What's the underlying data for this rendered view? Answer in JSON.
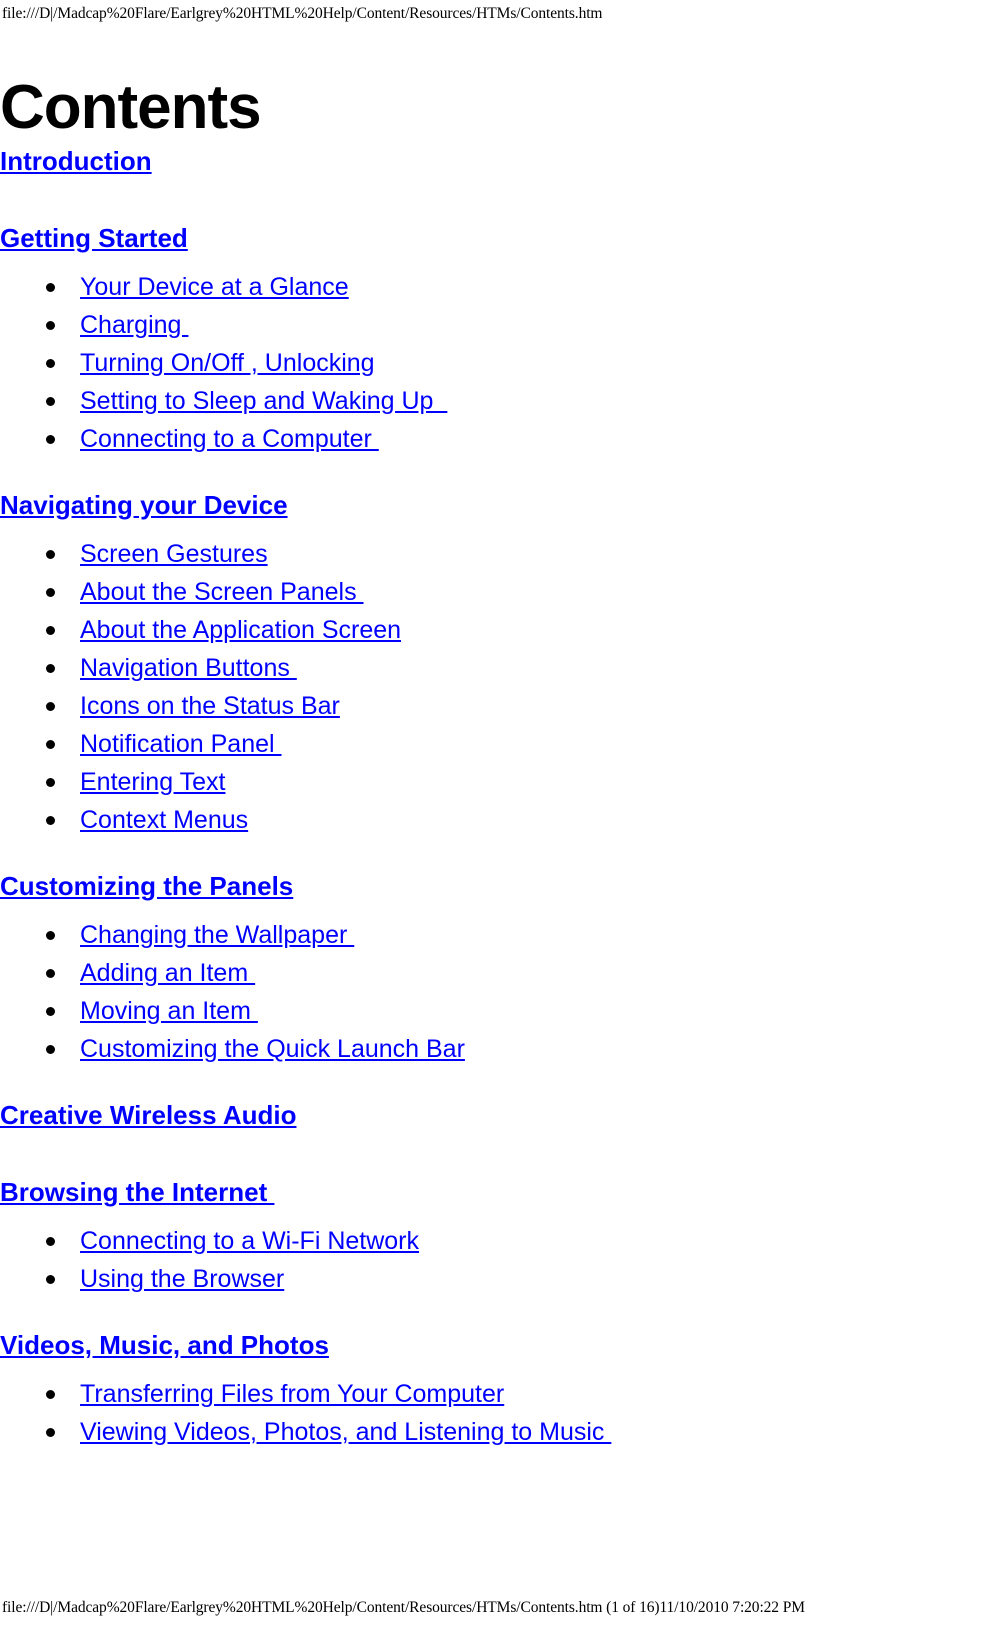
{
  "header": {
    "url": "file:///D|/Madcap%20Flare/Earlgrey%20HTML%20Help/Content/Resources/HTMs/Contents.htm"
  },
  "footer": {
    "url": "file:///D|/Madcap%20Flare/Earlgrey%20HTML%20Help/Content/Resources/HTMs/Contents.htm (1 of 16)11/10/2010 7:20:22 PM"
  },
  "document": {
    "title": "Contents",
    "link_color": "#0000ff",
    "text_color": "#000000",
    "background_color": "#ffffff"
  },
  "toc": {
    "sections": [
      {
        "heading": "Introduction",
        "items": []
      },
      {
        "heading": "Getting Started",
        "items": [
          "Your Device at a Glance",
          "Charging ",
          "Turning On/Off , Unlocking",
          "Setting to Sleep and Waking Up  ",
          "Connecting to a Computer "
        ]
      },
      {
        "heading": "Navigating your Device",
        "items": [
          "Screen Gestures",
          "About the Screen Panels ",
          "About the Application Screen",
          "Navigation Buttons ",
          "Icons on the Status Bar",
          "Notification Panel ",
          "Entering Text",
          "Context Menus"
        ]
      },
      {
        "heading": "Customizing the Panels",
        "items": [
          "Changing the Wallpaper ",
          "Adding an Item ",
          "Moving an Item ",
          "Customizing the Quick Launch Bar"
        ]
      },
      {
        "heading": "Creative Wireless Audio",
        "items": []
      },
      {
        "heading": "Browsing the Internet ",
        "items": [
          "Connecting to a Wi-Fi Network",
          "Using the Browser"
        ]
      },
      {
        "heading": "Videos, Music, and Photos",
        "items": [
          "Transferring Files from Your Computer",
          "Viewing Videos, Photos, and Listening to Music "
        ]
      }
    ]
  }
}
